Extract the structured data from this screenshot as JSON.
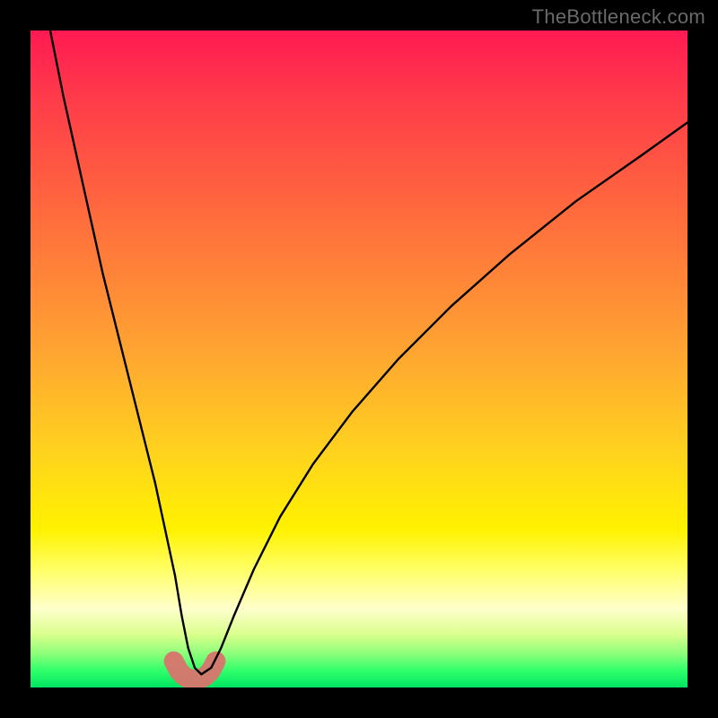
{
  "watermark": "TheBottleneck.com",
  "chart_data": {
    "type": "line",
    "title": "",
    "xlabel": "",
    "ylabel": "",
    "xlim": [
      0,
      100
    ],
    "ylim": [
      0,
      100
    ],
    "grid": false,
    "legend": false,
    "series": [
      {
        "name": "bottleneck-curve",
        "color": "#000000",
        "x": [
          3,
          5,
          7,
          9,
          11,
          13,
          15,
          17,
          19,
          20.5,
          22,
          23,
          24,
          25,
          26,
          27.5,
          29,
          31,
          34,
          38,
          43,
          49,
          56,
          64,
          73,
          83,
          93,
          100
        ],
        "y": [
          100,
          90,
          81,
          72,
          63,
          55,
          47,
          39,
          31,
          24,
          17,
          11,
          6,
          3,
          2,
          3,
          6,
          11,
          18,
          26,
          34,
          42,
          50,
          58,
          66,
          74,
          81,
          86
        ]
      }
    ],
    "markers": [
      {
        "name": "bottleneck-valley-highlight",
        "color": "#d9746e",
        "shape": "blob",
        "x_range": [
          21.5,
          28.5
        ],
        "y_level": 1.5,
        "points_x": [
          21.8,
          22.6,
          23.4,
          24.2,
          25.0,
          25.8,
          26.6,
          27.4,
          28.2
        ],
        "points_y": [
          4.0,
          2.5,
          1.7,
          1.3,
          1.2,
          1.3,
          1.7,
          2.5,
          4.0
        ]
      }
    ]
  }
}
